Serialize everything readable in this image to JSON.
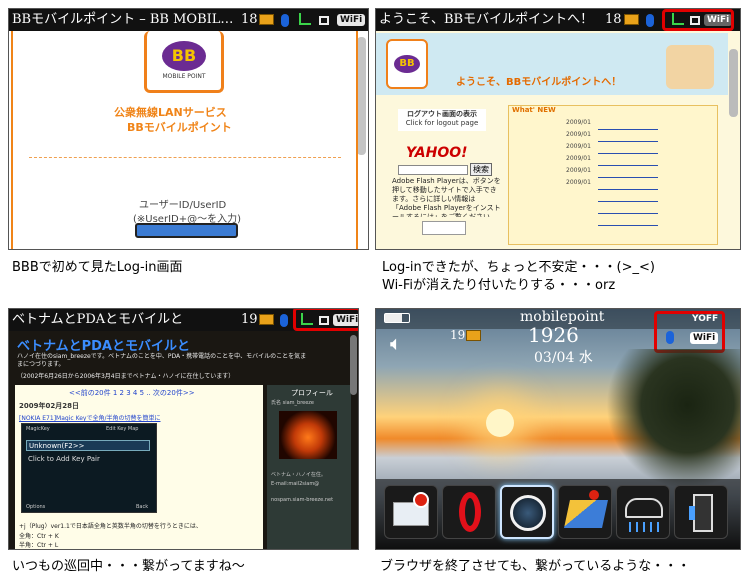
{
  "panel1": {
    "title": "BBモバイルポイント – BB MOBIL…",
    "count": "18",
    "wifi": "WiFi",
    "logo_text": "BB",
    "logo_sub": "MOBILE POINT",
    "heading1": "公衆無線LANサービス",
    "heading2": "BBモバイルポイント",
    "userid_label": "ユーザーID/UserID",
    "userid_hint": "(※UserID+@～を入力)",
    "caption": "BBBで初めて見たLog-in画面"
  },
  "panel2": {
    "title": "ようこそ、BBモバイルポイントへ！",
    "count": "18",
    "wifi": "WiFi",
    "welcome": "ようこそ、BBモバイルポイントへ！",
    "logout_title": "ログアウト画面の表示",
    "logout_sub": "Click for logout page",
    "whats_new": "What' NEW",
    "yahoo": "YAHOO!",
    "search_btn": "検索",
    "flash_text": "Adobe Flash Playerは、ボタンを押して移動したサイトで入手できます。さらに詳しい情報は「Adobe Flash Playerをインストールするには」をご覧ください。",
    "news_dates": [
      "2009/01",
      "2009/01",
      "2009/01",
      "2009/01",
      "2009/01",
      "2009/01"
    ],
    "caption1": "Log-inできたが、ちょっと不安定・・・(>_<)",
    "caption2": "Wi-Fiが消えたり付いたりする・・・orz"
  },
  "panel3": {
    "title": "ベトナムとPDAとモバイルと",
    "count": "19",
    "wifi": "WiFi",
    "blog_title": "ベトナムとPDAとモバイルと",
    "blog_intro": "ハノイ在住のsiam_breezeです。ベトナムのことを中、PDA・携帯電話のことを中、モバイルのことを気ままにつづります。",
    "blog_period": "（2002年6月26日から2006年3月4日までベトナム・ハノイに在住しています）",
    "nav_links": "<<前の20件 1 2 3 4 5 .. 次の20件>>",
    "post_date": "2009年02月28日",
    "post_title": "[NOKIA E71]Magic Keyで全角/半角の切替を簡単に",
    "app_title": "MagicKey",
    "app_edit": "Edit Key Map",
    "app_item1": "Unknown(F2>>",
    "app_item2": "Click to Add Key Pair",
    "app_options": "Options",
    "app_back": "Back",
    "profile_title": "プロフィール",
    "profile_name": "氏名 siam_breeze",
    "profile_desc": "ベトナム・ハノイ在住。",
    "profile_email": "E-mail:mail2siam@",
    "profile_url": "nospam.siam-breeze.net",
    "body1": "+j（Plug）ver1.1で日本語全角と英数半角の切替を行うときには、",
    "body2": "全角：Ctr + K",
    "body3": "半角：Ctr + L",
    "caption": "いつもの巡回中・・・繋がってますね～"
  },
  "panel4": {
    "carrier": "mobilepoint",
    "time": "1926",
    "date": "03/04 水",
    "count": "19",
    "off": "OFF",
    "wifi": "WiFi",
    "caption": "ブラウザを終了させても、繋がっているような・・・",
    "dock_icons": [
      "messages-icon",
      "opera-icon",
      "browser-icon",
      "maps-icon",
      "weather-icon",
      "more-apps-icon"
    ]
  },
  "colors": {
    "highlight": "#e20000",
    "orange": "#f08418",
    "accent_blue": "#1b63d9"
  }
}
